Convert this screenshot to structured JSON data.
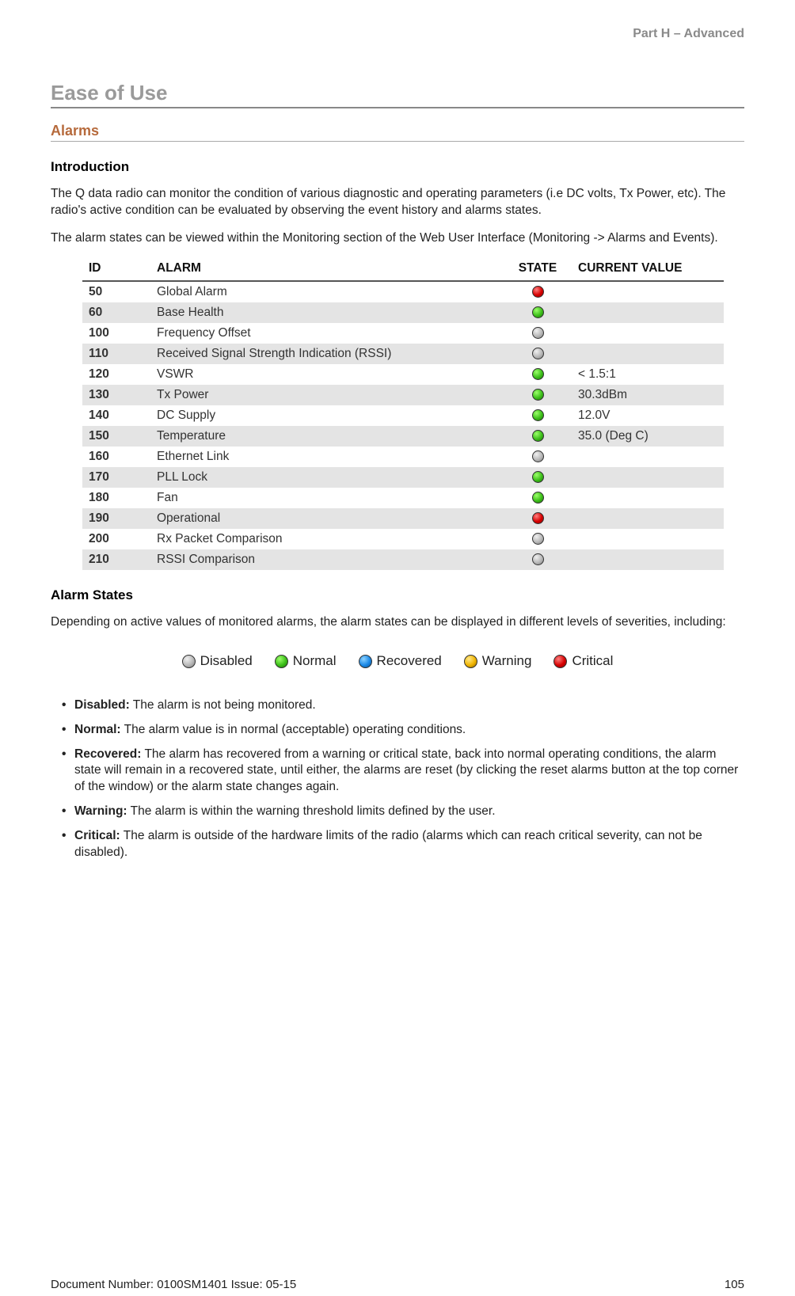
{
  "header": {
    "part": "Part H – Advanced"
  },
  "titles": {
    "h1": "Ease of Use",
    "h2": "Alarms",
    "intro_h": "Introduction",
    "states_h": "Alarm States"
  },
  "paragraphs": {
    "p1": "The Q data radio can monitor the condition of various diagnostic and operating parameters (i.e DC volts, Tx Power, etc). The radio's active condition can be evaluated by observing the event history and alarms states.",
    "p2": "The alarm states can be viewed within the Monitoring section of the Web User Interface (Monitoring -> Alarms and Events).",
    "p3": "Depending on active values of monitored alarms, the alarm states can be displayed in different levels of severities, including:"
  },
  "table": {
    "headers": {
      "id": "ID",
      "alarm": "ALARM",
      "state": "STATE",
      "value": "CURRENT VALUE"
    },
    "rows": [
      {
        "id": "50",
        "alarm": "Global Alarm",
        "state": "red",
        "value": ""
      },
      {
        "id": "60",
        "alarm": "Base Health",
        "state": "green",
        "value": ""
      },
      {
        "id": "100",
        "alarm": "Frequency Offset",
        "state": "grey",
        "value": ""
      },
      {
        "id": "110",
        "alarm": "Received Signal Strength Indication (RSSI)",
        "state": "grey",
        "value": ""
      },
      {
        "id": "120",
        "alarm": "VSWR",
        "state": "green",
        "value": "< 1.5:1"
      },
      {
        "id": "130",
        "alarm": "Tx Power",
        "state": "green",
        "value": "30.3dBm"
      },
      {
        "id": "140",
        "alarm": "DC Supply",
        "state": "green",
        "value": "12.0V"
      },
      {
        "id": "150",
        "alarm": "Temperature",
        "state": "green",
        "value": "35.0 (Deg C)"
      },
      {
        "id": "160",
        "alarm": "Ethernet Link",
        "state": "grey",
        "value": ""
      },
      {
        "id": "170",
        "alarm": "PLL Lock",
        "state": "green",
        "value": ""
      },
      {
        "id": "180",
        "alarm": "Fan",
        "state": "green",
        "value": ""
      },
      {
        "id": "190",
        "alarm": "Operational",
        "state": "red",
        "value": ""
      },
      {
        "id": "200",
        "alarm": "Rx Packet Comparison",
        "state": "grey",
        "value": ""
      },
      {
        "id": "210",
        "alarm": "RSSI Comparison",
        "state": "grey",
        "value": ""
      }
    ]
  },
  "legend": [
    {
      "color": "grey",
      "label": "Disabled"
    },
    {
      "color": "green",
      "label": "Normal"
    },
    {
      "color": "blue",
      "label": "Recovered"
    },
    {
      "color": "yellow",
      "label": "Warning"
    },
    {
      "color": "red",
      "label": "Critical"
    }
  ],
  "state_defs": [
    {
      "name": "Disabled:",
      "desc": " The alarm is not being monitored."
    },
    {
      "name": "Normal:",
      "desc": " The alarm value is in normal (acceptable) operating conditions."
    },
    {
      "name": "Recovered:",
      "desc": " The alarm has recovered from a warning or critical state, back into normal operating conditions, the alarm state will remain in a recovered state, until either, the alarms are reset (by clicking the reset alarms button at the top corner of the window) or the alarm state changes again."
    },
    {
      "name": "Warning:",
      "desc": " The alarm is within the warning threshold limits defined by the user."
    },
    {
      "name": "Critical:",
      "desc": " The alarm is outside of the hardware limits of the radio (alarms which can reach critical severity, can not be disabled)."
    }
  ],
  "footer": {
    "doc": "Document Number: 0100SM1401   Issue: 05-15",
    "page": "105"
  }
}
